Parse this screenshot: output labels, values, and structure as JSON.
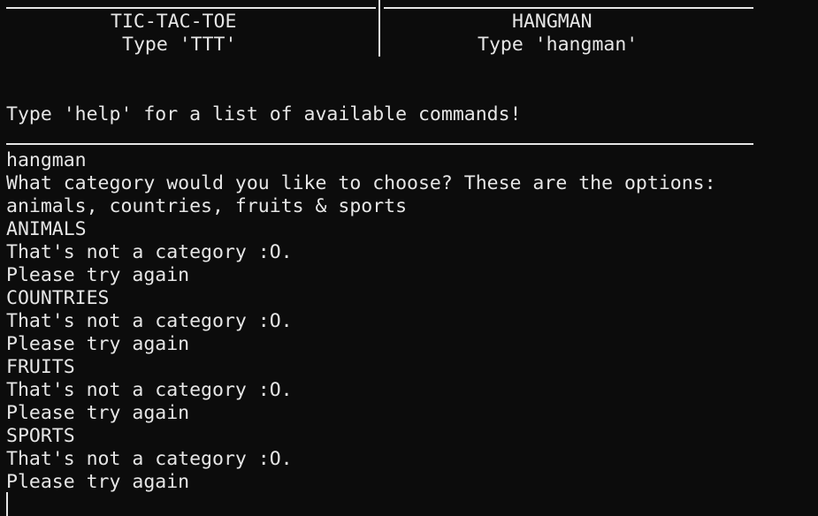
{
  "menu": {
    "left_title": "TIC-TAC-TOE",
    "left_hint": "Type 'TTT'",
    "right_title": "HANGMAN",
    "right_hint": "Type 'hangman'"
  },
  "help_text": "Type 'help' for a list of available commands!",
  "output_lines": [
    "hangman",
    "What category would you like to choose? These are the options:",
    "animals, countries, fruits & sports",
    "ANIMALS",
    "That's not a category :O.",
    "Please try again",
    "COUNTRIES",
    "That's not a category :O.",
    "Please try again",
    "FRUITS",
    "That's not a category :O.",
    "Please try again",
    "SPORTS",
    "That's not a category :O.",
    "Please try again"
  ]
}
